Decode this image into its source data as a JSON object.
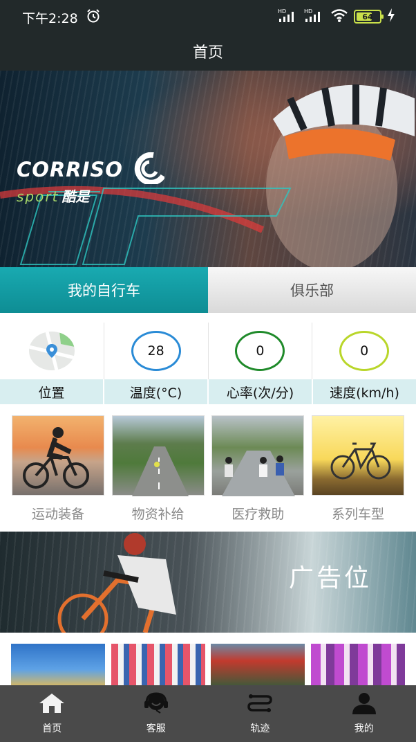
{
  "status_bar": {
    "time": "下午2:28",
    "battery_level": 64,
    "battery_text": "64"
  },
  "header": {
    "title": "首页"
  },
  "hero": {
    "brand_name": "CORRISO",
    "brand_sub": "sport",
    "brand_cn": "酷是"
  },
  "tabs": [
    {
      "label": "我的自行车",
      "active": true
    },
    {
      "label": "俱乐部",
      "active": false
    }
  ],
  "stats": {
    "location_label": "位置",
    "items": [
      {
        "label": "温度(°C)",
        "value": "28",
        "color": "#2a8bd6"
      },
      {
        "label": "心率(次/分)",
        "value": "0",
        "color": "#1f8a2a"
      },
      {
        "label": "速度(km/h)",
        "value": "0",
        "color": "#b9d62a"
      }
    ]
  },
  "services": [
    {
      "label": "运动装备"
    },
    {
      "label": "物资补给"
    },
    {
      "label": "医疗救助"
    },
    {
      "label": "系列车型"
    }
  ],
  "ad_banner": {
    "text": "广告位"
  },
  "bottom_nav": [
    {
      "label": "首页",
      "icon": "home-icon"
    },
    {
      "label": "客服",
      "icon": "headset-icon"
    },
    {
      "label": "轨迹",
      "icon": "route-icon"
    },
    {
      "label": "我的",
      "icon": "user-icon"
    }
  ],
  "colors": {
    "bar_background": "#22292a",
    "accent_teal": "#12a1a8",
    "nav_background": "#4a4a4a"
  }
}
